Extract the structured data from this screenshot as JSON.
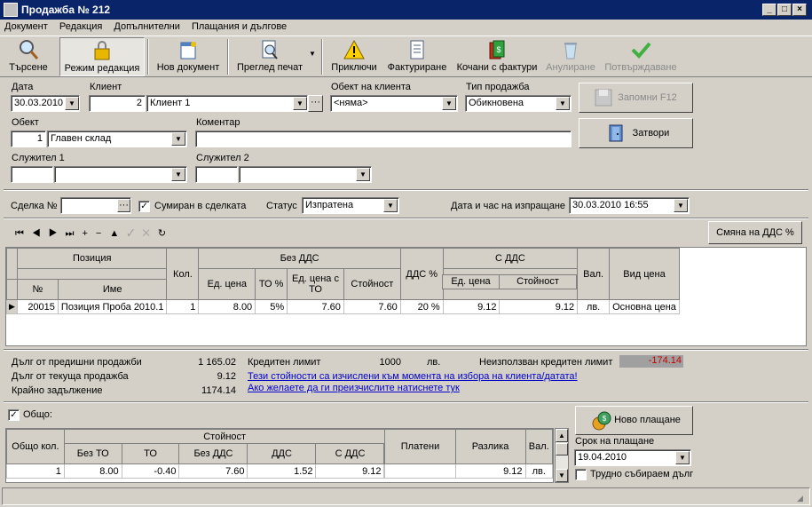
{
  "window": {
    "title": "Продажба № 212"
  },
  "menu": [
    "Документ",
    "Редакция",
    "Допълнителни",
    "Плащания и дългове"
  ],
  "toolbar": {
    "search": "Търсене",
    "edit_mode": "Режим редакция",
    "new_doc": "Нов документ",
    "print_preview": "Преглед печат",
    "finish": "Приключи",
    "invoicing": "Фактуриране",
    "attached_invoices": "Кочани с фактури",
    "cancel": "Анулиране",
    "confirm": "Потвърждаване"
  },
  "header": {
    "date_label": "Дата",
    "date_value": "30.03.2010",
    "client_label": "Клиент",
    "client_code": "2",
    "client_name": "Клиент 1",
    "client_object_label": "Обект на клиента",
    "client_object_value": "<няма>",
    "sale_type_label": "Тип продажба",
    "sale_type_value": "Обикновена",
    "object_label": "Обект",
    "object_code": "1",
    "object_name": "Главен склад",
    "comment_label": "Коментар",
    "comment_value": "",
    "employee1_label": "Служител 1",
    "employee2_label": "Служител 2",
    "save_button": "Запомни  F12",
    "close_button": "Затвори"
  },
  "deal": {
    "deal_label": "Сделка №",
    "deal_value": "",
    "summed_label": "Сумиран в сделката",
    "status_label": "Статус",
    "status_value": "Изпратена",
    "sent_label": "Дата и час на изпращане",
    "sent_value": "30.03.2010 16:55"
  },
  "items": {
    "vat_change_button": "Смяна на ДДС %",
    "headers": {
      "position": "Позиция",
      "no": "№",
      "name": "Име",
      "qty": "Кол.",
      "no_vat": "Без ДДС",
      "unit_price": "Ед. цена",
      "to_pct": "ТО %",
      "unit_price_to": "Ед. цена с ТО",
      "value": "Стойност",
      "vat_pct": "ДДС %",
      "with_vat": "С ДДС",
      "unit_price2": "Ед. цена",
      "value2": "Стойност",
      "currency": "Вал.",
      "price_type": "Вид цена"
    },
    "rows": [
      {
        "no": "20015",
        "name": "Позиция Проба 2010.1",
        "qty": "1",
        "unit_price": "8.00",
        "to_pct": "5%",
        "unit_price_to": "7.60",
        "value": "7.60",
        "vat_pct": "20 %",
        "unit_price2": "9.12",
        "value2": "9.12",
        "currency": "лв.",
        "price_type": "Основна цена"
      }
    ]
  },
  "debts": {
    "prev_label": "Дълг от предишни продажби",
    "prev_value": "1 165.02",
    "current_label": "Дълг от текуща продажба",
    "current_value": "9.12",
    "final_label": "Крайно задължение",
    "final_value": "1174.14",
    "credit_label": "Кредитен лимит",
    "credit_value": "1000",
    "credit_currency": "лв.",
    "unused_label": "Неизползван кредитен лимит",
    "unused_value": "-174.14",
    "link1": "Тези стойности са изчислени към момента на избора на клиента/датата!",
    "link2": "Ако желаете да ги преизчислите натиснете тук"
  },
  "totals": {
    "total_label": "Общо:",
    "headers": {
      "total_qty": "Общо кол.",
      "value": "Стойност",
      "no_to": "Без ТО",
      "to": "ТО",
      "no_vat": "Без ДДС",
      "vat": "ДДС",
      "with_vat": "С ДДС",
      "paid": "Платени",
      "diff": "Разлика",
      "currency": "Вал."
    },
    "row": {
      "total_qty": "1",
      "no_to": "8.00",
      "to": "-0.40",
      "no_vat": "7.60",
      "vat": "1.52",
      "with_vat": "9.12",
      "paid": "",
      "diff": "9.12",
      "currency": "лв."
    },
    "new_payment_button": "Ново плащане",
    "due_label": "Срок на плащане",
    "due_value": "19.04.2010",
    "hard_debt_label": "Трудно събираем дълг"
  },
  "colors": {
    "title_bg": "#0a246a",
    "window_bg": "#d4d0c8",
    "unused_credit_bg": "#a0a0a0",
    "unused_credit_text": "#cc0000",
    "link": "#0000cc"
  }
}
